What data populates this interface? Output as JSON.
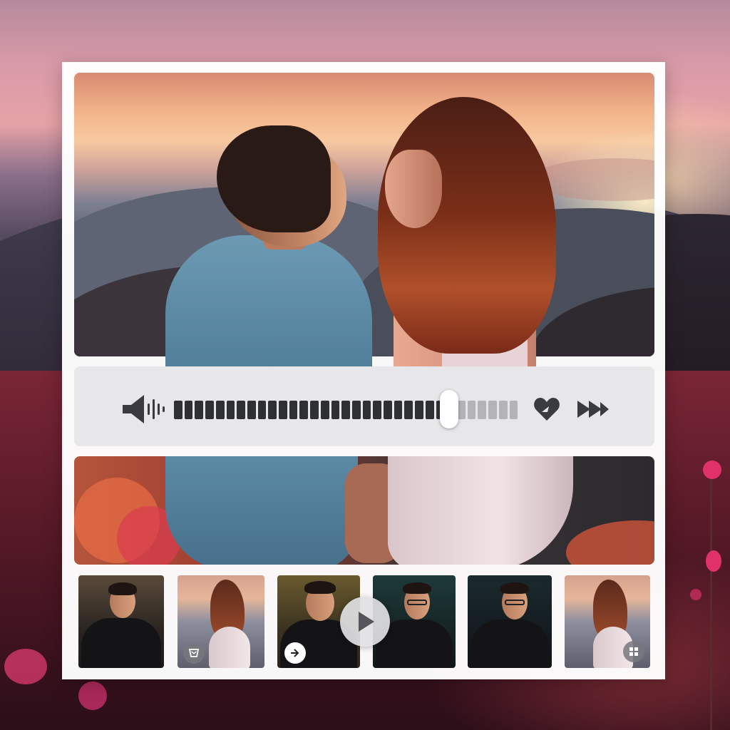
{
  "player": {
    "playback_progress": 0.8,
    "track_segments": 33,
    "icons": {
      "volume": "speaker-volume-icon",
      "favorite": "heart-icon",
      "fast_forward": "fast-forward-icon",
      "play": "play-icon"
    },
    "colors": {
      "played": "#2f3034",
      "remaining": "#b4b4b8",
      "panel": "#e7e6e8"
    }
  },
  "thumbnails": [
    {
      "subject": "man-portrait",
      "badge_icon": null
    },
    {
      "subject": "woman-mountains",
      "badge_icon": "gallery-icon"
    },
    {
      "subject": "man-smiling",
      "badge_icon": "share-arrow-icon"
    },
    {
      "subject": "man-glasses",
      "badge_icon": null
    },
    {
      "subject": "man-glasses-phone",
      "badge_icon": null
    },
    {
      "subject": "woman-mountains",
      "badge_icon": "grid-icon"
    }
  ],
  "accent": "#e0316a"
}
